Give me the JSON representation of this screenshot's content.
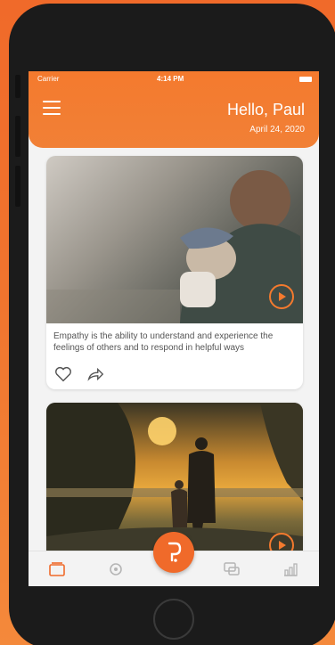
{
  "status_bar": {
    "carrier": "Carrier",
    "time": "4:14 PM"
  },
  "header": {
    "greeting": "Hello, Paul",
    "date": "April 24, 2020"
  },
  "feed": [
    {
      "caption": "Empathy is the ability to understand and experience the feelings of others and to respond in helpful ways"
    },
    {
      "caption": ""
    }
  ],
  "tabbar": {
    "items": [
      "home-icon",
      "gear-icon",
      "compose-icon",
      "chat-icon",
      "chart-icon"
    ],
    "accent": "#f06a2a"
  },
  "colors": {
    "accent": "#f47a2e",
    "background": "#f3f3f3"
  }
}
